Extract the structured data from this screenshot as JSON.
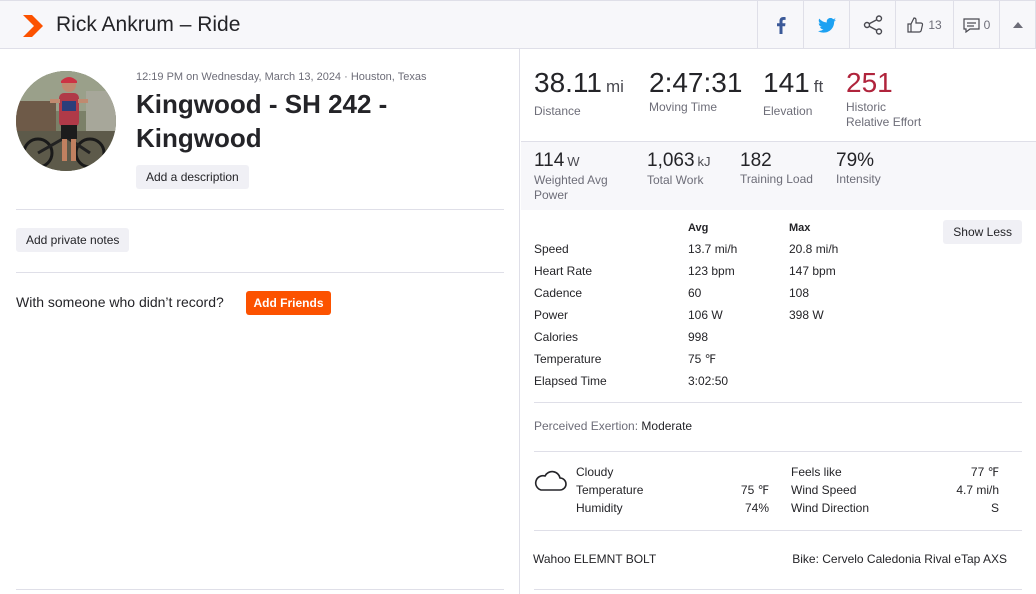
{
  "header": {
    "title": "Rick Ankrum – Ride",
    "logo_icon": "strava-chevron-icon",
    "kudos_count": "13",
    "comment_count": "0"
  },
  "activity": {
    "meta": "12:19 PM on Wednesday, March 13, 2024 · Houston, Texas",
    "name": "Kingwood - SH 242 - Kingwood",
    "add_description_label": "Add a description",
    "add_notes_label": "Add private notes",
    "with_someone_text": "With someone who didn’t record?",
    "add_friends_label": "Add Friends"
  },
  "primary_stats": [
    {
      "value": "38.11",
      "unit": "mi",
      "label": "Distance"
    },
    {
      "value": "2:47:31",
      "unit": "",
      "label": "Moving Time"
    },
    {
      "value": "141",
      "unit": "ft",
      "label": "Elevation"
    },
    {
      "value": "251",
      "unit": "",
      "label": "Historic",
      "label2": "Relative Effort"
    }
  ],
  "secondary_stats": [
    {
      "value": "114",
      "unit": "W",
      "label": "Weighted Avg",
      "label2": "Power"
    },
    {
      "value": "1,063",
      "unit": "kJ",
      "label": "Total Work",
      "label2": ""
    },
    {
      "value": "182",
      "unit": "",
      "label": "Training Load",
      "label2": ""
    },
    {
      "value": "79%",
      "unit": "",
      "label": "Intensity",
      "label2": ""
    }
  ],
  "more_stats": {
    "avg_header": "Avg",
    "max_header": "Max",
    "show_less_label": "Show Less",
    "rows": [
      {
        "label": "Speed",
        "avg": "13.7 mi/h",
        "max": "20.8 mi/h"
      },
      {
        "label": "Heart Rate",
        "avg": "123 bpm",
        "max": "147 bpm"
      },
      {
        "label": "Cadence",
        "avg": "60",
        "max": "108"
      },
      {
        "label": "Power",
        "avg": "106 W",
        "max": "398 W"
      },
      {
        "label": "Calories",
        "avg": "998",
        "max": ""
      },
      {
        "label": "Temperature",
        "avg": "75 ℉",
        "max": ""
      },
      {
        "label": "Elapsed Time",
        "avg": "3:02:50",
        "max": ""
      }
    ]
  },
  "perceived": {
    "label": "Perceived Exertion:",
    "value": "Moderate"
  },
  "weather": {
    "icon": "cloud-icon",
    "condition": "Cloudy",
    "temperature_label": "Temperature",
    "temperature_value": "75 ℉",
    "humidity_label": "Humidity",
    "humidity_value": "74%",
    "feels_like_label": "Feels like",
    "feels_like_value": "77 ℉",
    "wind_speed_label": "Wind Speed",
    "wind_speed_value": "4.7 mi/h",
    "wind_direction_label": "Wind Direction",
    "wind_direction_value": "S"
  },
  "gear": {
    "device": "Wahoo ELEMNT BOLT",
    "bike": "Bike: Cervelo Caledonia Rival eTap AXS"
  },
  "colors": {
    "brand_orange": "#fc5200",
    "relative_effort_red": "#b0243c",
    "facebook_blue": "#3b5998",
    "twitter_blue": "#1da1f2"
  }
}
